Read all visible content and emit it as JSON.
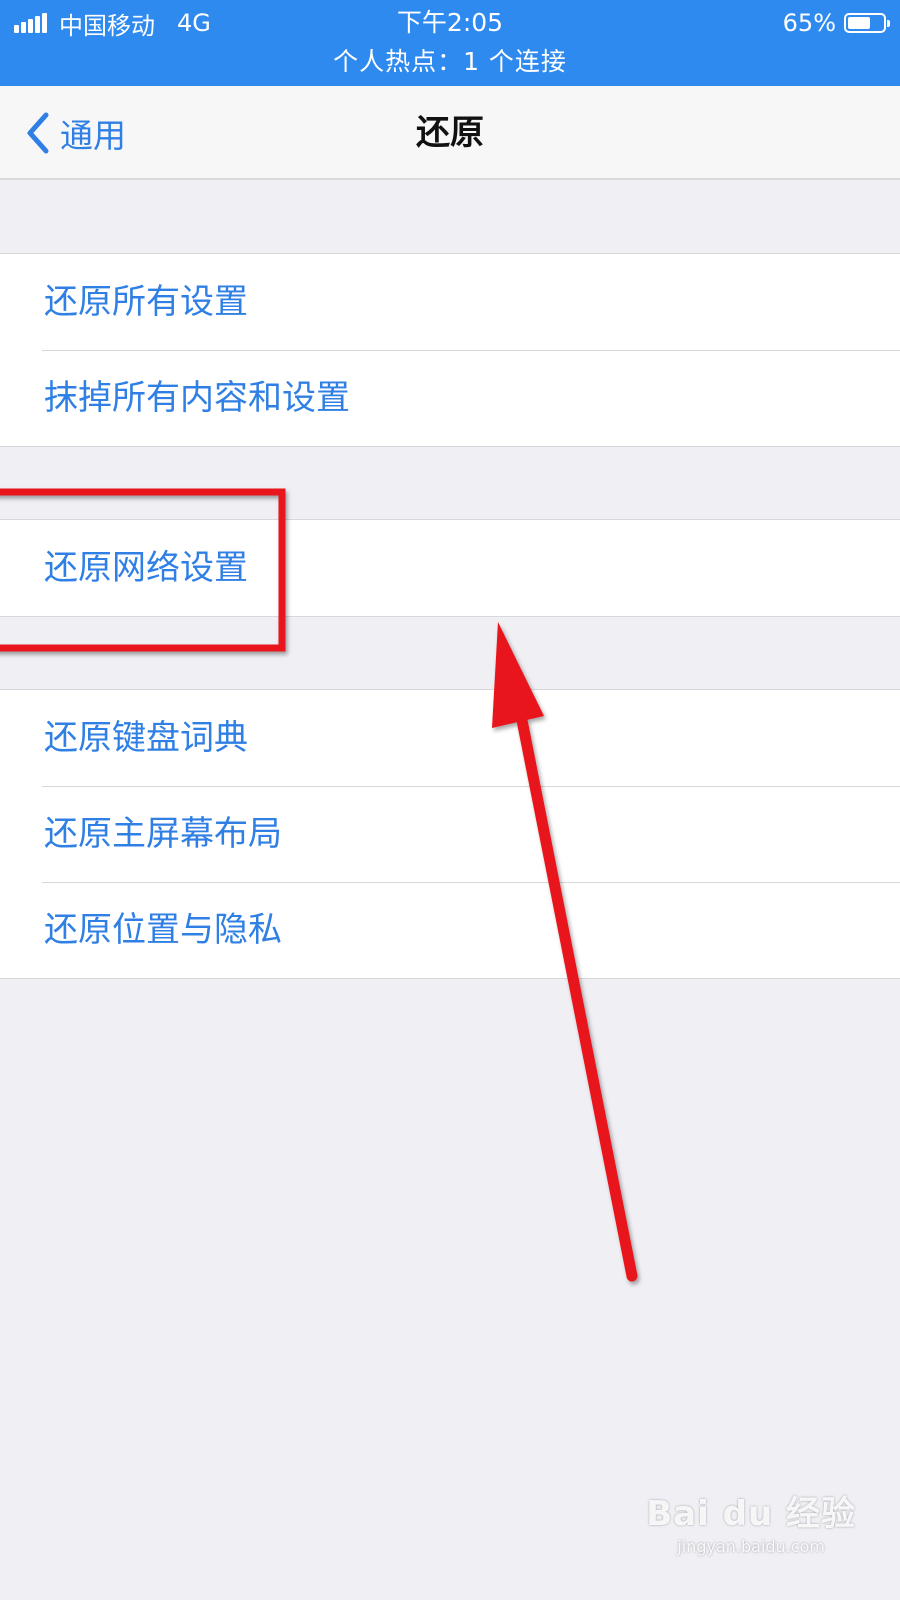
{
  "status_bar": {
    "carrier": "中国移动",
    "network": "4G",
    "time": "下午2:05",
    "battery_text": "65%",
    "battery_level": 0.65,
    "hotspot_text": "个人热点：1 个连接",
    "background_color": "#2f8af0"
  },
  "nav": {
    "back_label": "通用",
    "title": "还原",
    "back_icon": "chevron-left-icon"
  },
  "groups": [
    {
      "items": [
        "还原所有设置",
        "抹掉所有内容和设置"
      ]
    },
    {
      "items": [
        "还原网络设置"
      ]
    },
    {
      "items": [
        "还原键盘词典",
        "还原主屏幕布局",
        "还原位置与隐私"
      ]
    }
  ],
  "annotation": {
    "highlighted_item": "还原网络设置",
    "color": "#e8141a"
  },
  "watermark": {
    "main": "Bai du 经验",
    "sub": "jingyan.baidu.com"
  },
  "colors": {
    "accent": "#2f7fe4",
    "background": "#efeff4"
  }
}
